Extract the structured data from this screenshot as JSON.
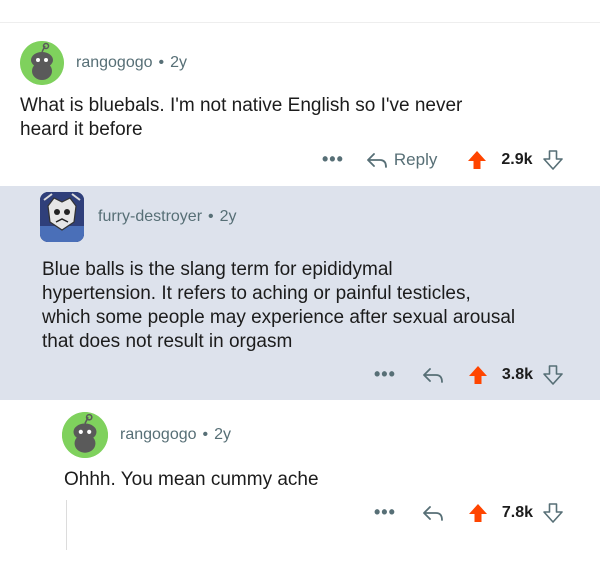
{
  "colors": {
    "upvote": "#ff4500",
    "meta_text": "#576f76",
    "highlight_bg": "#dde2ec",
    "avatar_green": "#7fd15d"
  },
  "comments": [
    {
      "username": "rangogogo",
      "separator": "•",
      "age": "2y",
      "body": "What is bluebals. I'm not native English so I've never\nheard it before",
      "more_label": "•••",
      "reply_label": "Reply",
      "score": "2.9k",
      "avatar_icon": "snoo-avatar-icon"
    },
    {
      "username": "furry-destroyer",
      "separator": "•",
      "age": "2y",
      "body": "Blue balls is the slang term for epididymal\nhypertension. It refers to aching or painful testicles,\nwhich some people may experience after sexual arousal\nthat does not result in orgasm",
      "more_label": "•••",
      "score": "3.8k",
      "avatar_icon": "custom-avatar-icon"
    },
    {
      "username": "rangogogo",
      "separator": "•",
      "age": "2y",
      "body": "Ohhh. You mean cummy ache",
      "more_label": "•••",
      "score": "7.8k",
      "avatar_icon": "snoo-avatar-icon"
    }
  ]
}
